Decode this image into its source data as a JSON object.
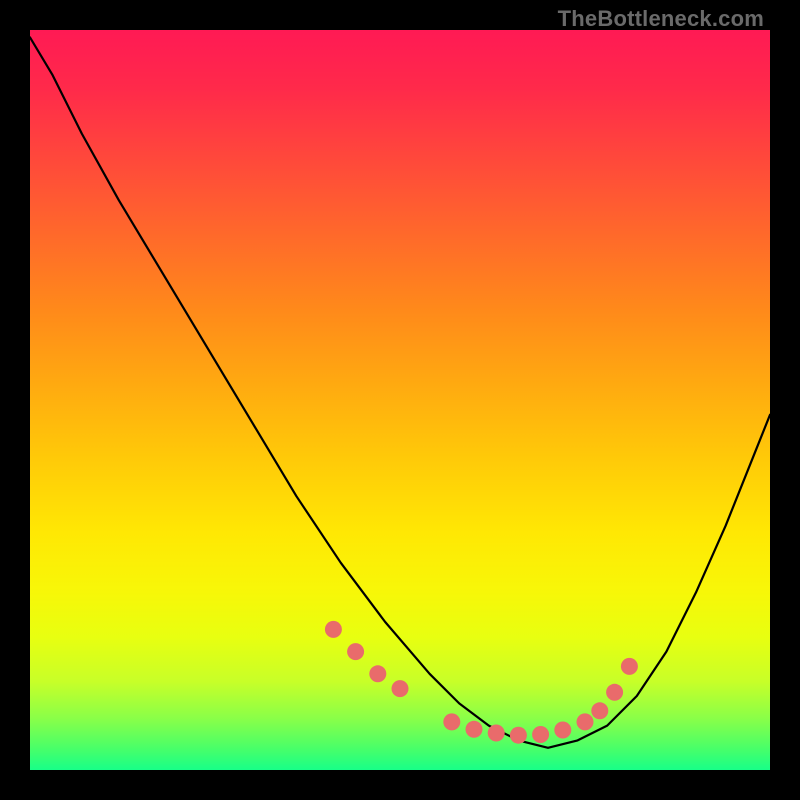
{
  "watermark": "TheBottleneck.com",
  "chart_data": {
    "type": "line",
    "title": "",
    "xlabel": "",
    "ylabel": "",
    "xlim": [
      0,
      100
    ],
    "ylim": [
      0,
      100
    ],
    "series": [
      {
        "name": "bottleneck-curve",
        "x": [
          0,
          3,
          7,
          12,
          18,
          24,
          30,
          36,
          42,
          48,
          54,
          58,
          62,
          66,
          70,
          74,
          78,
          82,
          86,
          90,
          94,
          98,
          100
        ],
        "y": [
          99,
          94,
          86,
          77,
          67,
          57,
          47,
          37,
          28,
          20,
          13,
          9,
          6,
          4,
          3,
          4,
          6,
          10,
          16,
          24,
          33,
          43,
          48
        ]
      }
    ],
    "markers": {
      "name": "highlight-points",
      "color": "#e96b6b",
      "x": [
        41,
        44,
        47,
        50,
        57,
        60,
        63,
        66,
        69,
        72,
        75,
        77,
        79,
        81
      ],
      "y": [
        19,
        16,
        13,
        11,
        6.5,
        5.5,
        5,
        4.7,
        4.8,
        5.4,
        6.5,
        8,
        10.5,
        14
      ]
    }
  }
}
